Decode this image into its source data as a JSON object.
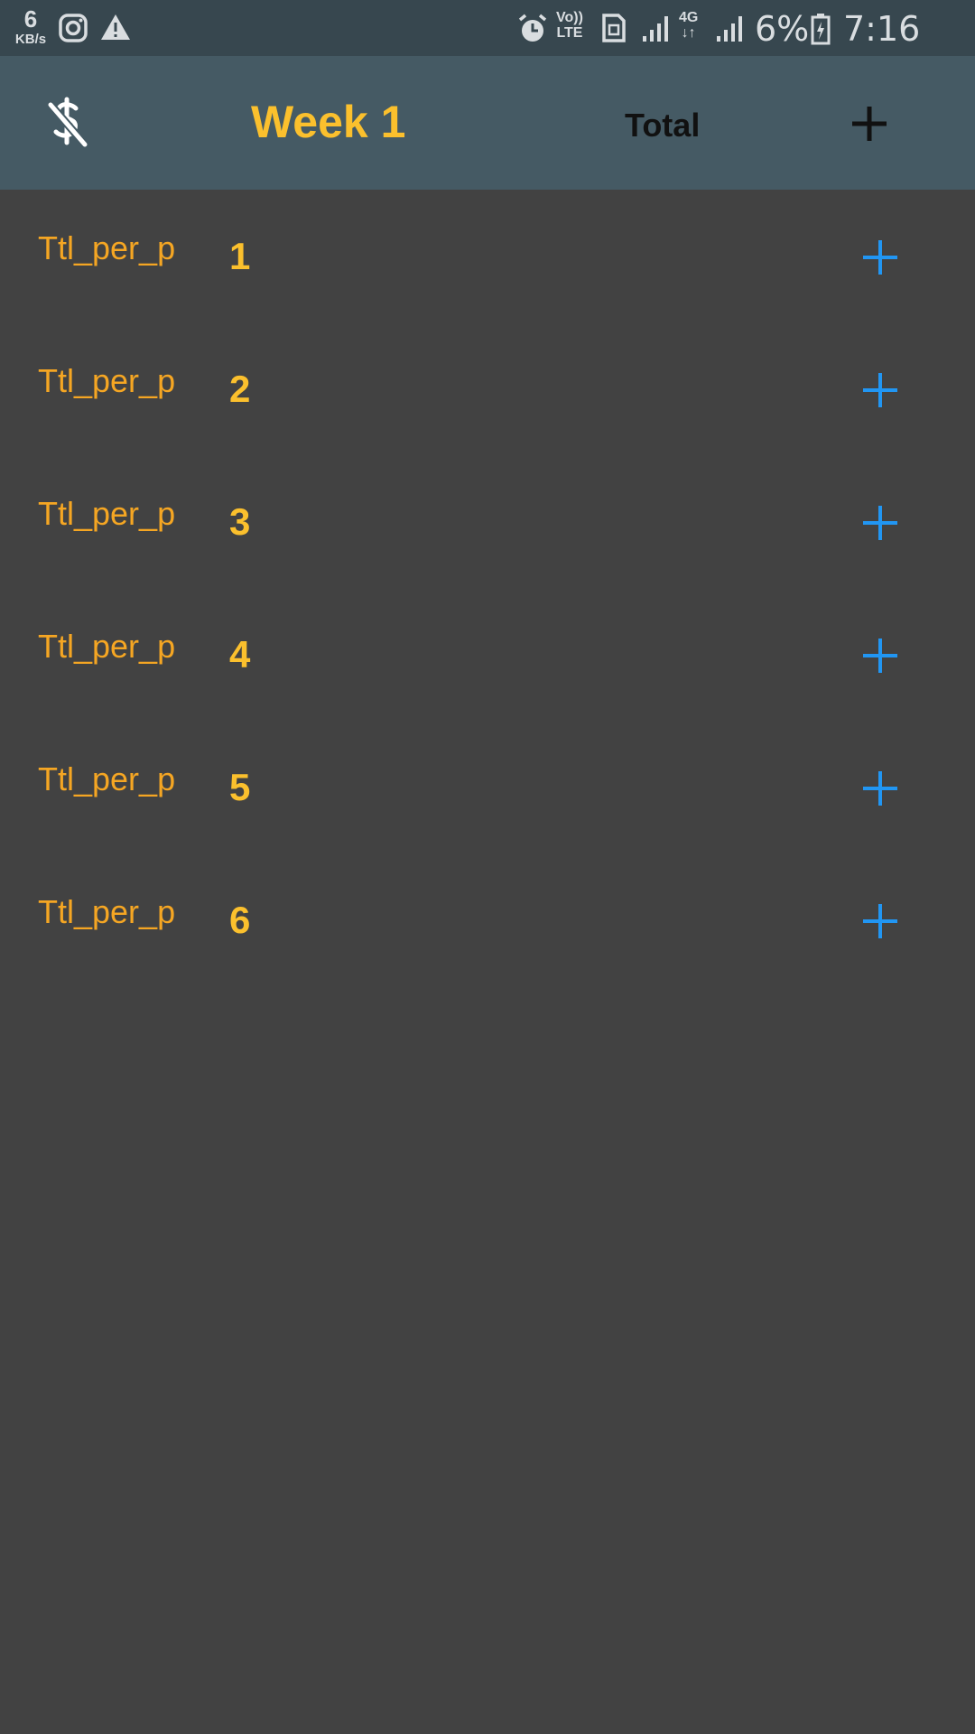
{
  "status_bar": {
    "speed_value": "6",
    "speed_unit": "KB/s",
    "volte_top": "Vo))",
    "volte_bottom": "LTE",
    "network_top": "4G",
    "network_bottom": "↓↑",
    "battery": "6%",
    "time": "7:16 pm",
    "icons": [
      "instagram-icon",
      "warning-icon",
      "alarm-icon",
      "sim-icon",
      "signal-icon",
      "battery-icon"
    ]
  },
  "app_bar": {
    "title": "Week 1",
    "total_label": "Total",
    "icons": [
      "money-off-icon",
      "add-icon"
    ]
  },
  "rows": [
    {
      "label": "Ttl_per_p",
      "number": "1"
    },
    {
      "label": "Ttl_per_p",
      "number": "2"
    },
    {
      "label": "Ttl_per_p",
      "number": "3"
    },
    {
      "label": "Ttl_per_p",
      "number": "4"
    },
    {
      "label": "Ttl_per_p",
      "number": "5"
    },
    {
      "label": "Ttl_per_p",
      "number": "6"
    }
  ],
  "colors": {
    "status_bar_bg": "#37474f",
    "app_bar_bg": "#455a64",
    "body_bg": "#424242",
    "title_yellow": "#fbc02d",
    "label_orange": "#f5a623",
    "plus_blue": "#2196f3"
  }
}
